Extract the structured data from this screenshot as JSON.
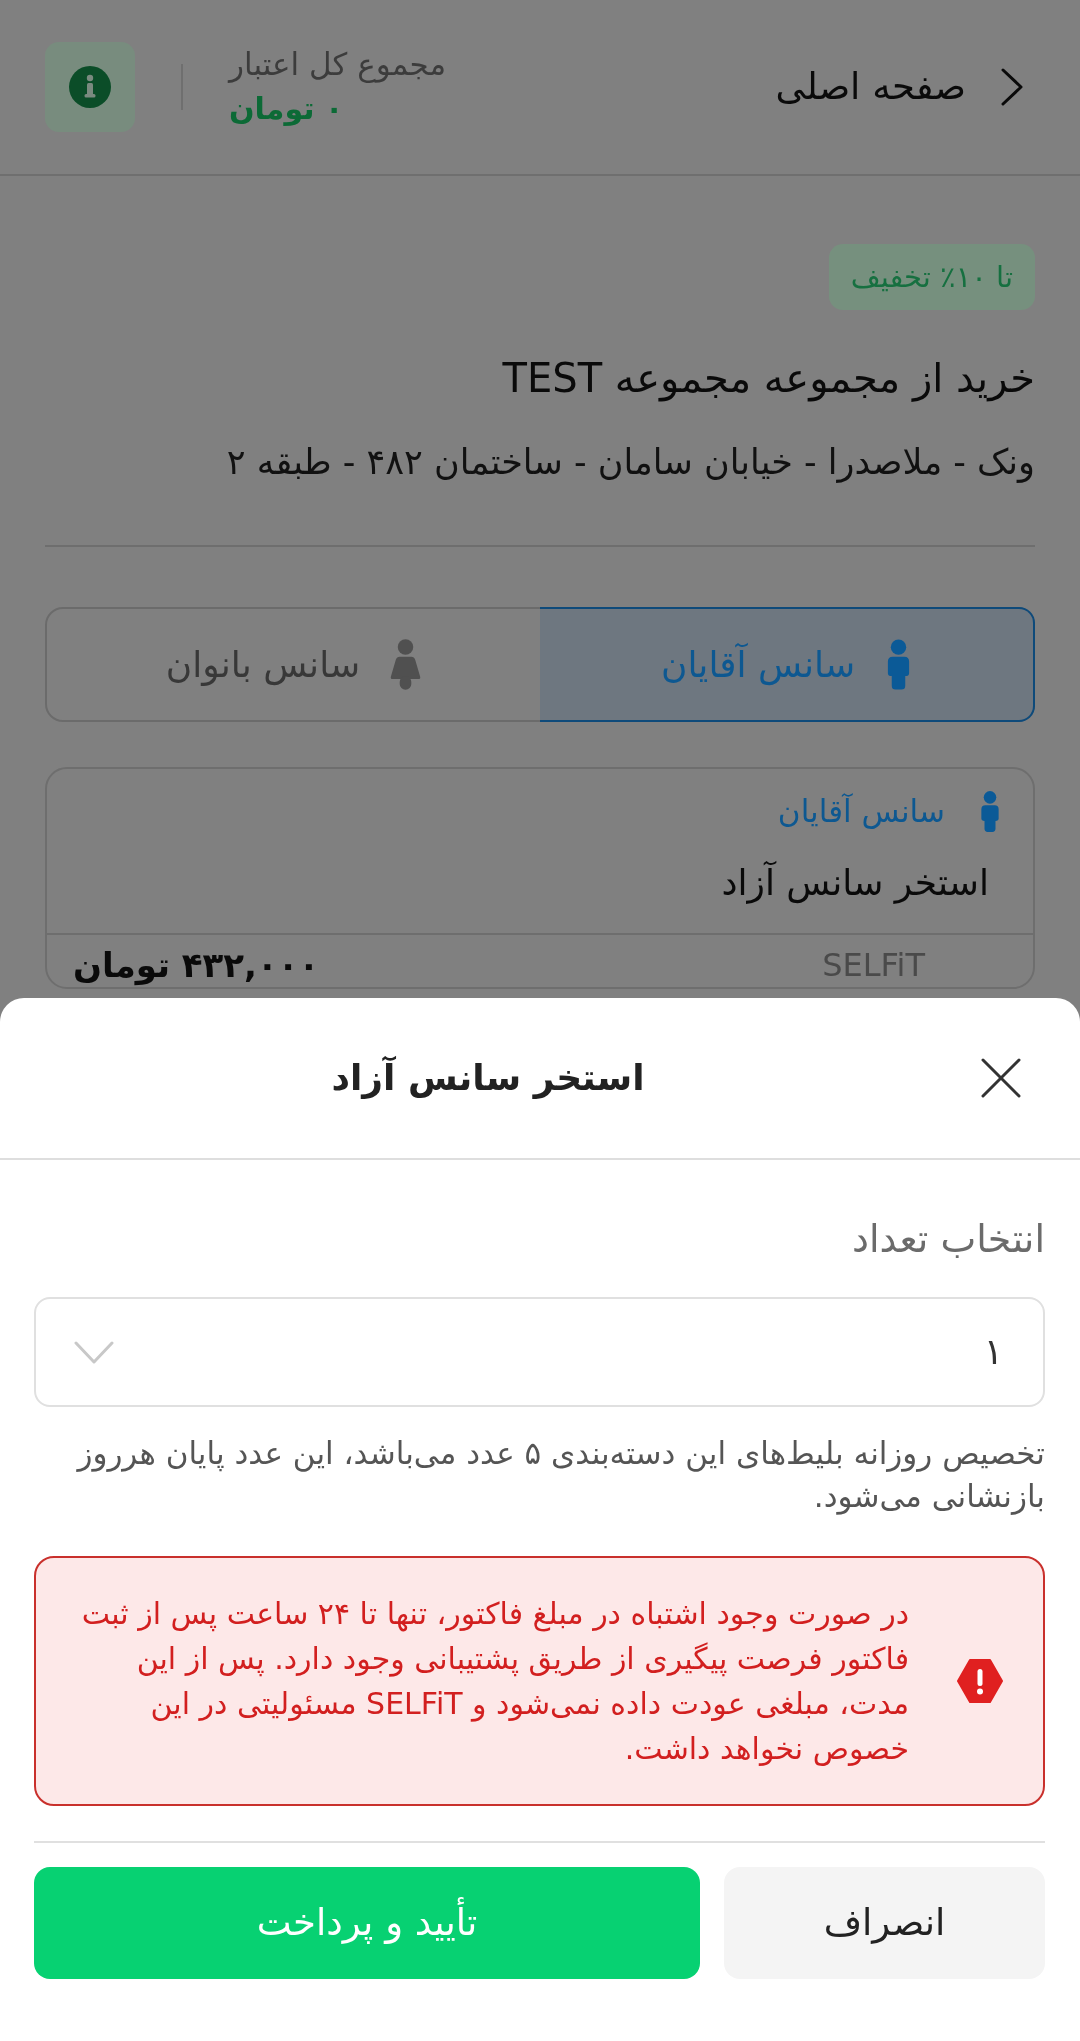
{
  "header": {
    "back_label": "صفحه اصلی",
    "credit_label": "مجموع کل اعتبار",
    "credit_value": "۰ تومان"
  },
  "venue": {
    "discount_badge": "تا ۱۰٪ تخفیف",
    "title": "خرید از مجموعه مجموعه TEST",
    "address": "ونک - ملاصدرا - خیابان سامان - ساختمان ۴۸۲ - طبقه ۲"
  },
  "session_tabs": [
    {
      "label": "سانس آقایان",
      "kind": "male",
      "selected": true
    },
    {
      "label": "سانس بانوان",
      "kind": "female",
      "selected": false
    }
  ],
  "ticket_card": {
    "session": {
      "label": "سانس آقایان",
      "kind": "male"
    },
    "name": "استخر سانس آزاد",
    "price_row": {
      "label": "SELFiT",
      "price": "۴۳۲,۰۰۰ تومان"
    }
  },
  "sheet": {
    "title": "استخر سانس آزاد",
    "quantity_label": "انتخاب تعداد",
    "quantity_select": {
      "value": "۱"
    },
    "note": "تخصیص روزانه بلیط‌های این دسته‌بندی ۵ عدد می‌باشد، این عدد پایان هرروز بازنشانی می‌شود.",
    "alert": "در صورت وجود اشتباه در مبلغ فاکتور، تنها تا ۲۴ ساعت پس از ثبت فاکتور فرصت پیگیری از طریق پشتیبانی وجود دارد. پس از این مدت، مبلغی عودت داده نمی‌شود و SELFiT مسئولیتی در این خصوص نخواهد داشت.",
    "buttons": [
      {
        "label": "انصراف",
        "kind": "secondary"
      },
      {
        "label": "تأیید و پرداخت",
        "kind": "primary"
      }
    ]
  }
}
